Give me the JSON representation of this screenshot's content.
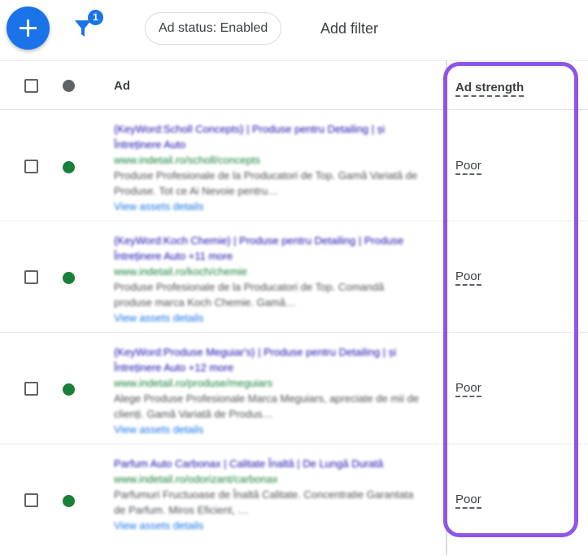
{
  "toolbar": {
    "filter_count": "1",
    "filter_chip": "Ad status: Enabled",
    "add_filter": "Add filter"
  },
  "table": {
    "header": {
      "ad": "Ad",
      "ad_strength": "Ad strength"
    },
    "rows": [
      {
        "title": "{KeyWord:Scholl Concepts} | Produse pentru Detailing | și Întreținere Auto",
        "url": "www.indetail.ro/scholl/concepts",
        "description": "Produse Profesionale de la Producatori de Top. Gamă Variată de Produse. Tot ce Ai Nevoie pentru…",
        "link": "View assets details",
        "strength": "Poor",
        "status": "enabled"
      },
      {
        "title": "{KeyWord:Koch Chemie} | Produse pentru Detailing | Produse Întreținere Auto +11 more",
        "url": "www.indetail.ro/koch/chemie",
        "description": "Produse Profesionale de la Producatori de Top. Comandă produse marca Koch Chemie. Gamă…",
        "link": "View assets details",
        "strength": "Poor",
        "status": "enabled"
      },
      {
        "title": "{KeyWord:Produse Meguiar's} | Produse pentru Detailing | și Întreținere Auto +12 more",
        "url": "www.indetail.ro/produse/meguiars",
        "description": "Alege Produse Profesionale Marca Meguiars, apreciate de mii de clienți. Gamă Variată de Produs…",
        "link": "View assets details",
        "strength": "Poor",
        "status": "enabled"
      },
      {
        "title": "Parfum Auto Carbonax | Calitate Înaltă | De Lungă Durată",
        "url": "www.indetail.ro/odorizant/carbonax",
        "description": "Parfumuri Fructuoase de Înaltă Calitate. Concentratie Garantata de Parfum. Miros Eficient, …",
        "link": "View assets details",
        "strength": "Poor",
        "status": "enabled"
      }
    ]
  },
  "colors": {
    "accent": "#1a73e8",
    "status_enabled": "#188038",
    "status_header": "#5f6368",
    "highlight": "#8e55e6"
  }
}
